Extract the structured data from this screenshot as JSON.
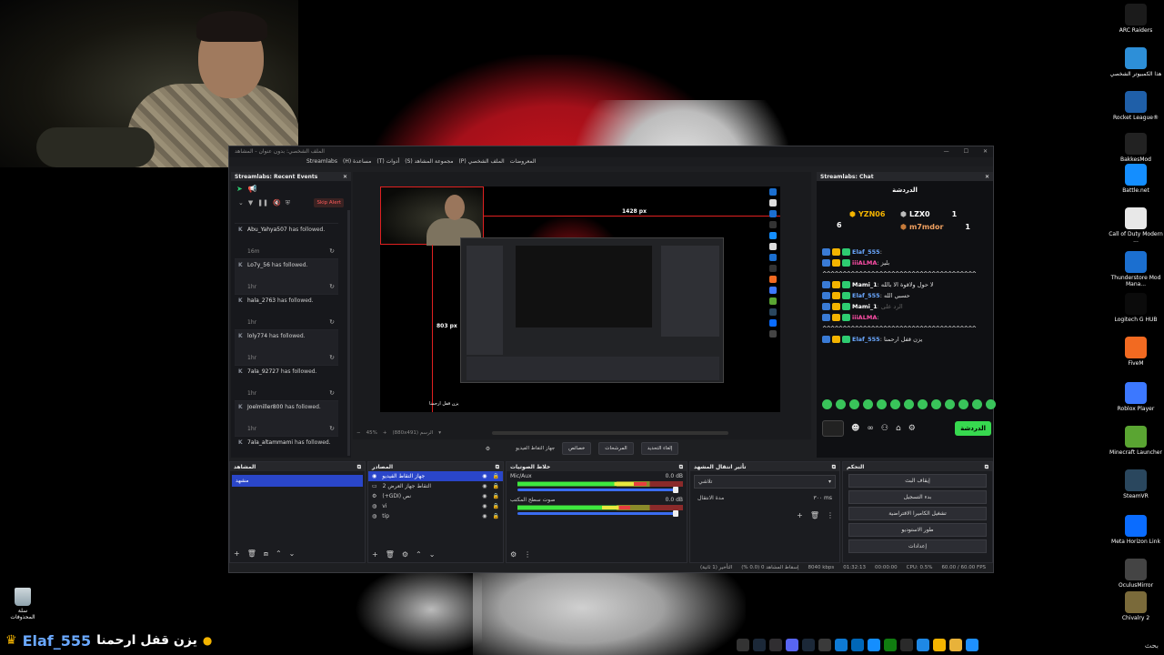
{
  "desktop": {
    "icons": [
      {
        "label": "ARC Raiders",
        "icon": "arc-raiders-icon",
        "color": "#1b1b1b"
      },
      {
        "label": "هذا الكمبيوتر الشخصي",
        "icon": "this-pc-icon",
        "color": "#2d8fd8"
      },
      {
        "label": "Rocket League®",
        "icon": "rocket-league-icon",
        "color": "#1f5fa8"
      },
      {
        "label": "BakkesMod",
        "icon": "bakkesmod-icon",
        "color": "#222222"
      },
      {
        "label": "Battle.net",
        "icon": "battlenet-icon",
        "color": "#148eff"
      },
      {
        "label": "Call of Duty Modern ...",
        "icon": "file-icon",
        "color": "#e8e8e8"
      },
      {
        "label": "Thunderstore Mod Mana...",
        "icon": "thunderstore-icon",
        "color": "#1b6fd0"
      },
      {
        "label": "Logitech G HUB",
        "icon": "logitech-icon",
        "color": "#0b0b0b"
      },
      {
        "label": "FiveM",
        "icon": "fivem-icon",
        "color": "#f26a21"
      },
      {
        "label": "Roblox Player",
        "icon": "roblox-icon",
        "color": "#3c78ff"
      },
      {
        "label": "Minecraft Launcher",
        "icon": "minecraft-icon",
        "color": "#5aa532"
      },
      {
        "label": "SteamVR",
        "icon": "steamvr-icon",
        "color": "#2a475e"
      },
      {
        "label": "Meta Horizon Link",
        "icon": "meta-icon",
        "color": "#0a6cff"
      },
      {
        "label": "OculusMirror",
        "icon": "oculus-icon",
        "color": "#444444"
      },
      {
        "label": "Chivalry 2",
        "icon": "chivalry-icon",
        "color": "#7a6a3a"
      }
    ],
    "recycle_bin": "سلة المحذوفات"
  },
  "overlay": {
    "username": "Elaf_555",
    "message": "يزن قفل ارحمنا"
  },
  "taskbar": {
    "search_label": "بحث",
    "icons": [
      {
        "icon": "chevron-icon",
        "color": "#333333"
      },
      {
        "icon": "steam-icon",
        "color": "#1b2838"
      },
      {
        "icon": "obs-icon",
        "color": "#302e31"
      },
      {
        "icon": "discord-icon",
        "color": "#5865f2"
      },
      {
        "icon": "steam-icon",
        "color": "#1b2838"
      },
      {
        "icon": "browser-icon",
        "color": "#3a3a3a"
      },
      {
        "icon": "edge-icon",
        "color": "#0e7ad4"
      },
      {
        "icon": "store-icon",
        "color": "#0067b8"
      },
      {
        "icon": "battlenet-icon",
        "color": "#148eff"
      },
      {
        "icon": "xbox-icon",
        "color": "#107c10"
      },
      {
        "icon": "epic-icon",
        "color": "#2a2a2a"
      },
      {
        "icon": "app-icon",
        "color": "#1e88e5"
      },
      {
        "icon": "chrome-icon",
        "color": "#f4b400"
      },
      {
        "icon": "folder-icon",
        "color": "#e8b23a"
      },
      {
        "icon": "start-icon",
        "color": "#1e90ff"
      }
    ]
  },
  "obs": {
    "title": "الملف الشخصي: بدون عنوان - المشاهد",
    "menu": [
      "Streamlabs",
      "(H) مساعدة",
      "(T) أدوات",
      "(S) مجموعة المشاهد",
      "(P) الملف الشخصي",
      "المعروضات"
    ],
    "events": {
      "title": "Streamlabs: Recent Events",
      "skip_alert": "Skip Alert",
      "items": [
        {
          "name": "Abu_Yahya507",
          "text": "has followed.",
          "time": "16m"
        },
        {
          "name": "Lo7y_56",
          "text": "has followed.",
          "time": "1hr"
        },
        {
          "name": "hala_2763",
          "text": "has followed.",
          "time": "1hr"
        },
        {
          "name": "loly774",
          "text": "has followed.",
          "time": "1hr"
        },
        {
          "name": "7ala_92727",
          "text": "has followed.",
          "time": "1hr"
        },
        {
          "name": "Joelmiller800",
          "text": "has followed.",
          "time": "1hr"
        },
        {
          "name": "7ala_altammami",
          "text": "has followed.",
          "time": "1hr"
        }
      ]
    },
    "preview": {
      "width_label": "1428 px",
      "height_label": "803 px",
      "caption": "يزن قفل ارحمنا",
      "status_zoom": "45%",
      "status_size": "(880x491) الرسم"
    },
    "preview_controls": [
      "إلغاء التحديد",
      "المرشحات",
      "خصائص",
      "جهاز التقاط الفيديو"
    ],
    "chat": {
      "title": "Streamlabs: Chat",
      "header": "الدردشة",
      "leaders": [
        {
          "name": "YZN06",
          "count": "6",
          "color": "#f4b400"
        },
        {
          "name": "LZX0",
          "count": "1",
          "color": "#bbbbbb"
        },
        {
          "name": "m7mdor",
          "count": "1",
          "color": "#c57a3a"
        }
      ],
      "lines": [
        {
          "user": "Elaf_555",
          "cls": "u-blue",
          "text": ""
        },
        {
          "user": "iiiALMA",
          "cls": "u-pink",
          "text": "بليز"
        },
        {
          "user": "",
          "cls": "u-white",
          "text": "^^^^^^^^^^^^^^^^^^^^^^^^^^^^^^^^^^^^^^"
        },
        {
          "user": "Mami_1",
          "cls": "u-white",
          "text": "لا حول ولاقوة الا بالله"
        },
        {
          "user": "Elaf_555",
          "cls": "u-blue",
          "text": "حسبي الله"
        },
        {
          "user": "Mami_1",
          "cls": "u-white",
          "text": "الرد على",
          "dim": true
        },
        {
          "user": "iiiALMA",
          "cls": "u-pink",
          "text": ""
        },
        {
          "user": "",
          "cls": "u-white",
          "text": "^^^^^^^^^^^^^^^^^^^^^^^^^^^^^^^^^^^^^^"
        },
        {
          "user": "Elaf_555",
          "cls": "u-blue",
          "text": "يزن قفل ارحمنا"
        }
      ],
      "send_label": "الدردشة"
    },
    "docks": {
      "scenes_title": "المشاهد",
      "scene_item": "مشهد",
      "sources_title": "المصادر",
      "sources": [
        {
          "icon": "camera-icon",
          "name": "جهاز التقاط الفيديو"
        },
        {
          "icon": "monitor-icon",
          "name": "التقاط جهاز العرض 2"
        },
        {
          "icon": "gear-icon",
          "name": "(+GDI) نص"
        },
        {
          "icon": "globe-icon",
          "name": "vi"
        },
        {
          "icon": "globe-icon",
          "name": "tip"
        }
      ],
      "mixer_title": "خلاط الصوتيات",
      "mixer": [
        {
          "name": "Mic/Aux",
          "db": "0.0 dB",
          "level": 0.78
        },
        {
          "name": "صوت سطح المكتب",
          "db": "0.0 dB",
          "level": 0.68
        }
      ],
      "transitions_title": "تأثير انتقال المشهد",
      "transition": "تلاشي",
      "duration_label": "مدة الانتقال",
      "duration": "٣٠٠ ms",
      "controls_title": "التحكم",
      "controls": [
        "إيقاف البث",
        "بدء التسجيل",
        "تشغيل الكاميرا الافتراضية",
        "طور الاستوديو",
        "إعدادات"
      ]
    },
    "statusbar": [
      "التأخير (1 ثانية)",
      "إسقاط المشاهد 0 (0.0 %)",
      "8040 kbps",
      "01:32:13",
      "00:00:00",
      "CPU: 0.5%",
      "60.00 / 60.00 FPS"
    ]
  }
}
